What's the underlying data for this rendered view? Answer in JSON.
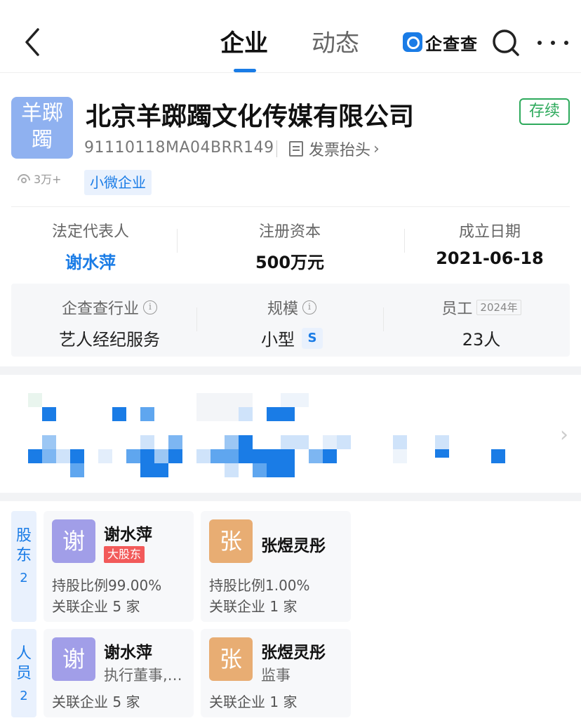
{
  "nav": {
    "tab_company": "企业",
    "tab_news": "动态",
    "brand": "企查查"
  },
  "colors": {
    "accent": "#1a7ce6",
    "status_green": "#2eaa5c",
    "major_red": "#f25a5a"
  },
  "company": {
    "logo_line1": "羊踯",
    "logo_line2": "躅",
    "name": "北京羊踯躅文化传媒有限公司",
    "status": "存续",
    "credit_code": "91110118MA04BRR149",
    "invoice_label": "发票抬头",
    "views": "3万+",
    "tag": "小微企业"
  },
  "key_info": [
    {
      "label": "法定代表人",
      "value": "谢水萍"
    },
    {
      "label": "注册资本",
      "value": "500万元"
    },
    {
      "label": "成立日期",
      "value": "2021-06-18"
    }
  ],
  "detail_info": {
    "industry_label": "企查查行业",
    "industry_value": "艺人经纪服务",
    "scale_label": "规模",
    "scale_value": "小型",
    "scale_badge": "S",
    "staff_label": "员工",
    "staff_year": "2024年",
    "staff_value": "23人"
  },
  "shareholders": {
    "tab_label": "股东",
    "count": "2",
    "items": [
      {
        "avatar": "谢",
        "name": "谢水萍",
        "tag": "大股东",
        "ratio": "持股比例99.00%",
        "related": "关联企业 5 家"
      },
      {
        "avatar": "张",
        "name": "张煜灵彤",
        "ratio": "持股比例1.00%",
        "related": "关联企业 1 家"
      }
    ]
  },
  "staff": {
    "tab_label": "人员",
    "count": "2",
    "items": [
      {
        "avatar": "谢",
        "name": "谢水萍",
        "role": "执行董事,…",
        "related": "关联企业 5 家"
      },
      {
        "avatar": "张",
        "name": "张煜灵彤",
        "role": "监事",
        "related": "关联企业 1 家"
      }
    ]
  }
}
